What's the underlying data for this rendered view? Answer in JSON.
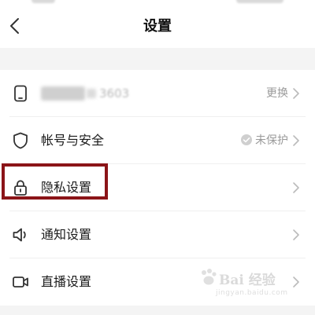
{
  "header": {
    "title": "设置"
  },
  "account": {
    "masked_phone_visible_digits": "3603",
    "change_label": "更换"
  },
  "rows": [
    {
      "label": "帐号与安全",
      "status": "未保护"
    },
    {
      "label": "隐私设置"
    },
    {
      "label": "通知设置"
    },
    {
      "label": "直播设置"
    }
  ],
  "watermark": {
    "brand": "Bai 经验",
    "url": "jingyan.baidu.com"
  },
  "colors": {
    "highlight": "#8b1418",
    "muted_text": "#9a9a9a",
    "icon_stroke": "#333333"
  },
  "icons": {
    "back": "chevron-left-icon",
    "phone": "phone-icon",
    "shield": "shield-icon",
    "lock": "lock-icon",
    "speaker": "speaker-icon",
    "live": "video-camera-icon",
    "chevron": "chevron-right-icon"
  }
}
